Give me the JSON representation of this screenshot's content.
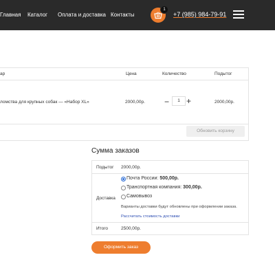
{
  "header": {
    "nav": [
      "Главная",
      "Каталог",
      "Оплата и доставка",
      "Контакты"
    ],
    "cart_count": "1",
    "phone": "+7 (985) 984-79-91",
    "cart_icon": "basket-icon",
    "menu_icon": "hamburger-icon",
    "accent_color": "#ee7d2e"
  },
  "cart": {
    "columns": {
      "product": "ар",
      "price": "Цена",
      "quantity": "Количество",
      "subtotal": "Подытог"
    },
    "item": {
      "name": "ломства для крупных собак — «Набор XL»",
      "price": "2000,00р.",
      "qty": "1",
      "subtotal": "2000,00р."
    },
    "qty_minus": "−",
    "qty_plus": "+",
    "update_label": "Обновить корзину"
  },
  "totals": {
    "title": "Сумма заказов",
    "subtotal_label": "Подытог",
    "subtotal_value": "2000,00р.",
    "shipping_label": "Доставка",
    "options": [
      {
        "name": "Почта России:",
        "price": "500,00р.",
        "selected": true
      },
      {
        "name": "Транспортная компания:",
        "price": "300,00р.",
        "selected": false
      },
      {
        "name": "Самовывоз",
        "price": "",
        "selected": false
      }
    ],
    "shipping_note": "Варианты доставки будут обновлены при оформлении заказа.",
    "calc_link": "Рассчитать стоимость доставки",
    "total_label": "Итого",
    "total_value": "2500,00р."
  },
  "checkout_label": "Оформить заказ"
}
